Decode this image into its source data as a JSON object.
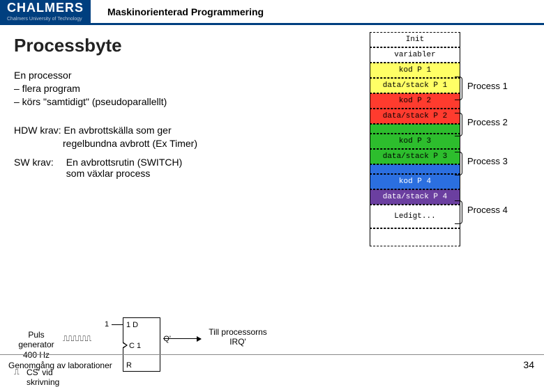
{
  "header": {
    "logo_text": "CHALMERS",
    "logo_sub": "Chalmers University of Technology",
    "course": "Maskinorienterad Programmering"
  },
  "slide": {
    "title": "Processbyte",
    "intro_l1": "En processor",
    "intro_l2": "– flera program",
    "intro_l3": "– körs \"samtidigt\" (pseudoparallellt)",
    "hdw": "HDW krav: En avbrottskälla som ger",
    "hdw2": "                  regelbundna avbrott (Ex Timer)",
    "sw_label": "SW krav:",
    "sw_text1": "En avbrottsrutin (SWITCH)",
    "sw_text2": "som växlar process"
  },
  "memory": {
    "init": "Init",
    "vars": "variabler",
    "p1k": "kod P 1",
    "p1d": "data/stack P 1",
    "p2k": "kod P 2",
    "p2d": "data/stack P 2",
    "p3k": "kod P 3",
    "p3d": "data/stack P 3",
    "p4k": "kod P 4",
    "p4d": "data/stack P 4",
    "free": "Ledigt...",
    "labels": [
      "Process 1",
      "Process 2",
      "Process 3",
      "Process 4"
    ]
  },
  "diagram": {
    "puls": "Puls generator 400 Hz",
    "one": "1",
    "d1": "1 D",
    "c1": "C 1",
    "r": "R",
    "q": "Q'",
    "cs": "CS' vid skrivning",
    "irq": "Till processorns IRQ'"
  },
  "footer": {
    "text": "Genomgång av laborationer",
    "page": "34"
  }
}
